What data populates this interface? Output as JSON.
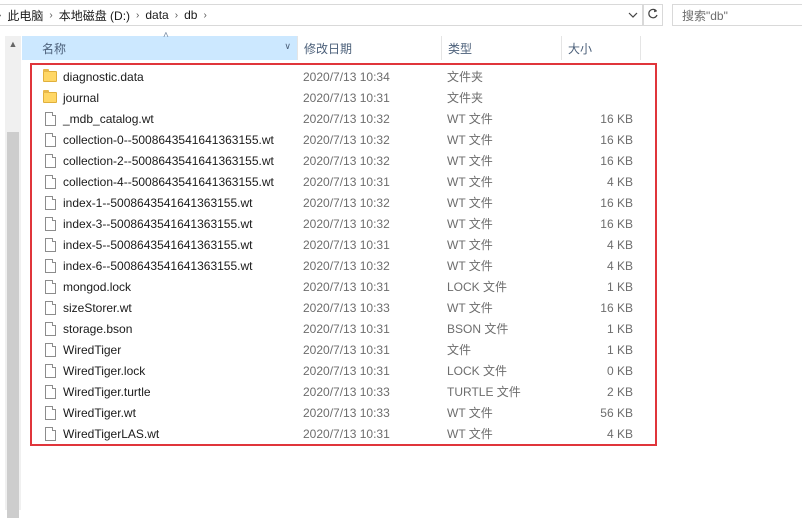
{
  "breadcrumb": {
    "items": [
      "此电脑",
      "本地磁盘 (D:)",
      "data",
      "db"
    ]
  },
  "search": {
    "placeholder": "搜索\"db\""
  },
  "columns": {
    "name": "名称",
    "date": "修改日期",
    "type": "类型",
    "size": "大小"
  },
  "files": [
    {
      "name": "diagnostic.data",
      "date": "2020/7/13 10:34",
      "type": "文件夹",
      "size": "",
      "icon": "folder-icon"
    },
    {
      "name": "journal",
      "date": "2020/7/13 10:31",
      "type": "文件夹",
      "size": "",
      "icon": "folder-icon"
    },
    {
      "name": "_mdb_catalog.wt",
      "date": "2020/7/13 10:32",
      "type": "WT 文件",
      "size": "16 KB",
      "icon": "file-icon"
    },
    {
      "name": "collection-0--5008643541641363155.wt",
      "date": "2020/7/13 10:32",
      "type": "WT 文件",
      "size": "16 KB",
      "icon": "file-icon"
    },
    {
      "name": "collection-2--5008643541641363155.wt",
      "date": "2020/7/13 10:32",
      "type": "WT 文件",
      "size": "16 KB",
      "icon": "file-icon"
    },
    {
      "name": "collection-4--5008643541641363155.wt",
      "date": "2020/7/13 10:31",
      "type": "WT 文件",
      "size": "4 KB",
      "icon": "file-icon"
    },
    {
      "name": "index-1--5008643541641363155.wt",
      "date": "2020/7/13 10:32",
      "type": "WT 文件",
      "size": "16 KB",
      "icon": "file-icon"
    },
    {
      "name": "index-3--5008643541641363155.wt",
      "date": "2020/7/13 10:32",
      "type": "WT 文件",
      "size": "16 KB",
      "icon": "file-icon"
    },
    {
      "name": "index-5--5008643541641363155.wt",
      "date": "2020/7/13 10:31",
      "type": "WT 文件",
      "size": "4 KB",
      "icon": "file-icon"
    },
    {
      "name": "index-6--5008643541641363155.wt",
      "date": "2020/7/13 10:32",
      "type": "WT 文件",
      "size": "4 KB",
      "icon": "file-icon"
    },
    {
      "name": "mongod.lock",
      "date": "2020/7/13 10:31",
      "type": "LOCK 文件",
      "size": "1 KB",
      "icon": "file-icon"
    },
    {
      "name": "sizeStorer.wt",
      "date": "2020/7/13 10:33",
      "type": "WT 文件",
      "size": "16 KB",
      "icon": "file-icon"
    },
    {
      "name": "storage.bson",
      "date": "2020/7/13 10:31",
      "type": "BSON 文件",
      "size": "1 KB",
      "icon": "file-icon"
    },
    {
      "name": "WiredTiger",
      "date": "2020/7/13 10:31",
      "type": "文件",
      "size": "1 KB",
      "icon": "file-icon"
    },
    {
      "name": "WiredTiger.lock",
      "date": "2020/7/13 10:31",
      "type": "LOCK 文件",
      "size": "0 KB",
      "icon": "file-icon"
    },
    {
      "name": "WiredTiger.turtle",
      "date": "2020/7/13 10:33",
      "type": "TURTLE 文件",
      "size": "2 KB",
      "icon": "file-icon"
    },
    {
      "name": "WiredTiger.wt",
      "date": "2020/7/13 10:33",
      "type": "WT 文件",
      "size": "56 KB",
      "icon": "file-icon"
    },
    {
      "name": "WiredTigerLAS.wt",
      "date": "2020/7/13 10:31",
      "type": "WT 文件",
      "size": "4 KB",
      "icon": "file-icon"
    }
  ],
  "colors": {
    "header_selected": "#cce8ff",
    "highlight_border": "#e0353b",
    "folder": "#ffd766"
  }
}
